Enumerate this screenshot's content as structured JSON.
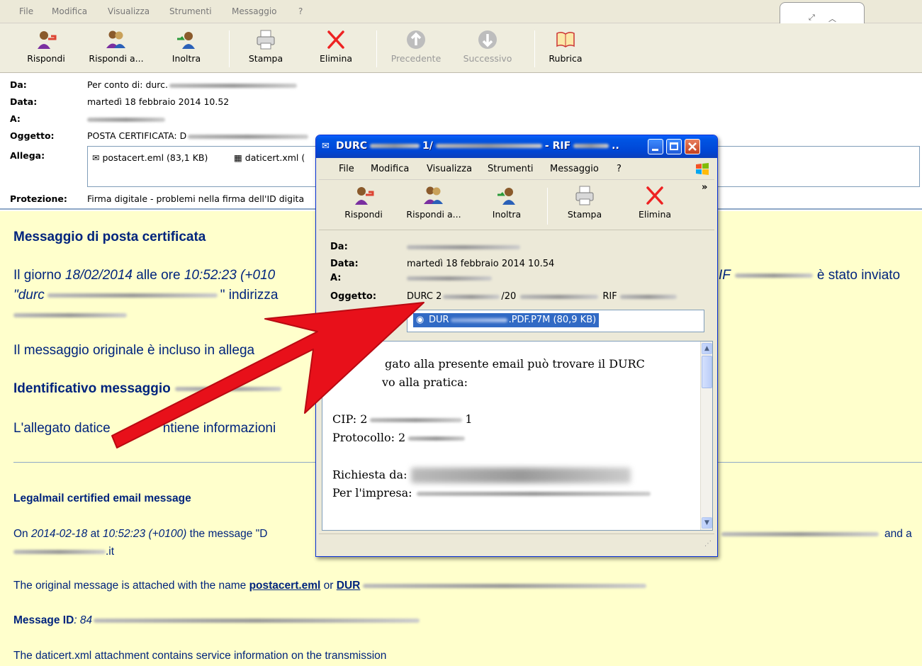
{
  "menubar": {
    "items": [
      "File",
      "Modifica",
      "Visualizza",
      "Strumenti",
      "Messaggio",
      "?"
    ]
  },
  "toolbar": {
    "reply": "Rispondi",
    "reply_all": "Rispondi a...",
    "forward": "Inoltra",
    "print": "Stampa",
    "delete": "Elimina",
    "previous": "Precedente",
    "next": "Successivo",
    "addressbook": "Rubrica"
  },
  "header": {
    "from_label": "Da:",
    "from_value": "Per conto di: durc.",
    "date_label": "Data:",
    "date_value": "martedì 18 febbraio 2014 10.52",
    "to_label": "A:",
    "subject_label": "Oggetto:",
    "subject_value": "POSTA CERTIFICATA: D",
    "attach_label": "Allega:",
    "attachments": [
      "postacert.eml (83,1 KB)",
      "daticert.xml ("
    ],
    "security_label": "Protezione:",
    "security_value": "Firma digitale - problemi nella firma dell'ID digita"
  },
  "body": {
    "title": "Messaggio di posta certificata",
    "p1_a": "Il giorno ",
    "p1_date": "18/02/2014",
    "p1_b": " alle ore ",
    "p1_time": "10:52:23 (+010",
    "p1_right": "è stato inviato",
    "p1_rif": "IF",
    "p2_a": "\"durc",
    "p2_b": "\" indirizza",
    "p3": "Il messaggio originale è incluso in allega",
    "id_label": "Identificativo messaggio",
    "p4_a": "L'allegato datice",
    "p4_b": "ntiene informazioni",
    "en_title": "Legalmail certified email message",
    "en_p1_a": "On ",
    "en_p1_date": "2014-02-18",
    "en_p1_b": " at ",
    "en_p1_time": "10:52:23 (+0100)",
    "en_p1_c": " the message \"D",
    "en_p1_right": "and a",
    "en_p1_line2": ".it",
    "en_p2_a": "The original message is attached with the name ",
    "en_p2_link": "postacert.eml",
    "en_p2_b": " or ",
    "en_p2_link2": "DUR",
    "en_id_label": "Message ID",
    "en_id_value": ": 84",
    "en_p3": "The daticert.xml attachment contains service information on the transmission"
  },
  "popup": {
    "title_a": "DURC",
    "title_b": "1/",
    "title_c": "- RIF",
    "title_d": "..",
    "menu": [
      "File",
      "Modifica",
      "Visualizza",
      "Strumenti",
      "Messaggio",
      "?"
    ],
    "toolbar": {
      "reply": "Rispondi",
      "reply_all": "Rispondi a...",
      "forward": "Inoltra",
      "print": "Stampa",
      "delete": "Elimina",
      "more": "»"
    },
    "from_label": "Da:",
    "date_label": "Data:",
    "date_value": "martedì 18 febbraio 2014 10.54",
    "to_label": "A:",
    "subject_label": "Oggetto:",
    "subject_a": "DURC 2",
    "subject_b": "/20",
    "subject_c": "RIF",
    "attachment_a": "DUR",
    "attachment_b": ".PDF.P7M (80,9 KB)",
    "body_l1": "gato alla presente email può trovare il DURC",
    "body_l2": "vo alla pratica:",
    "body_cip": "CIP: 2",
    "body_cip_end": "1",
    "body_prot": "Protocollo: 2",
    "body_req": "Richiesta da:",
    "body_imp": "Per l'impresa:"
  },
  "colors": {
    "arrow": "#e8101a",
    "title_bar": "#0054e3",
    "body_bg": "#ffffcc",
    "text_blue": "#00247d"
  }
}
